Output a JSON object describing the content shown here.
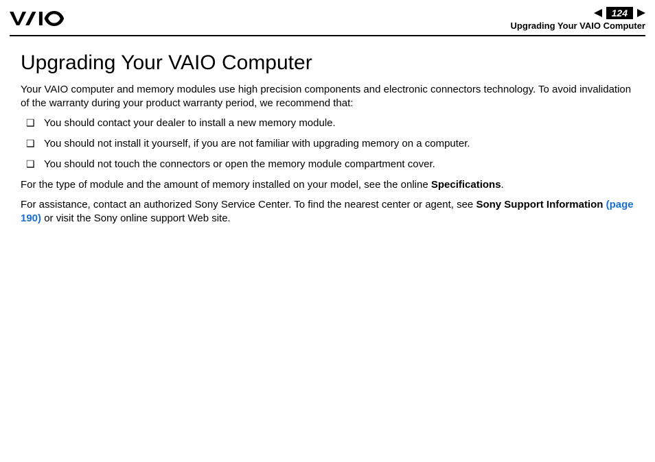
{
  "header": {
    "page_number": "124",
    "breadcrumb": "Upgrading Your VAIO Computer"
  },
  "content": {
    "title": "Upgrading Your VAIO Computer",
    "intro": "Your VAIO computer and memory modules use high precision components and electronic connectors technology. To avoid invalidation of the warranty during your product warranty period, we recommend that:",
    "bullets": [
      "You should contact your dealer to install a new memory module.",
      "You should not install it yourself, if you are not familiar with upgrading memory on a computer.",
      "You should not touch the connectors or open the memory module compartment cover."
    ],
    "para2_pre": "For the type of module and the amount of memory installed on your model, see the online ",
    "para2_bold": "Specifications",
    "para2_post": ".",
    "para3_pre": "For assistance, contact an authorized Sony Service Center. To find the nearest center or agent, see ",
    "para3_bold": "Sony Support Information ",
    "para3_link": "(page 190)",
    "para3_post": " or visit the Sony online support Web site."
  }
}
